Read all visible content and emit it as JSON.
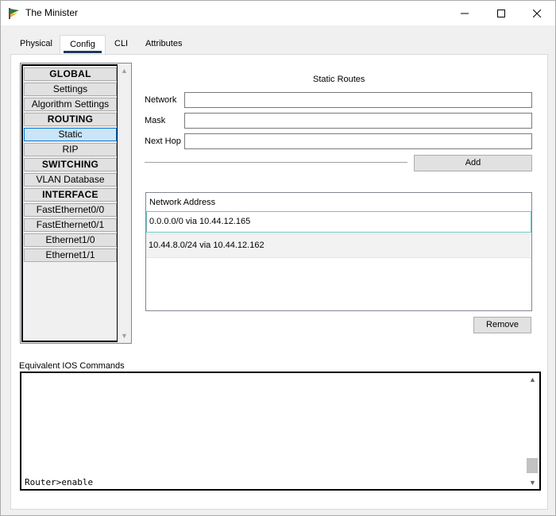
{
  "window": {
    "title": "The Minister"
  },
  "tabs": [
    {
      "label": "Physical"
    },
    {
      "label": "Config"
    },
    {
      "label": "CLI"
    },
    {
      "label": "Attributes"
    }
  ],
  "nav": {
    "items": [
      {
        "label": "GLOBAL",
        "kind": "header"
      },
      {
        "label": "Settings",
        "kind": "item"
      },
      {
        "label": "Algorithm Settings",
        "kind": "item"
      },
      {
        "label": "ROUTING",
        "kind": "header"
      },
      {
        "label": "Static",
        "kind": "item",
        "selected": true
      },
      {
        "label": "RIP",
        "kind": "item"
      },
      {
        "label": "SWITCHING",
        "kind": "header"
      },
      {
        "label": "VLAN Database",
        "kind": "item"
      },
      {
        "label": "INTERFACE",
        "kind": "header"
      },
      {
        "label": "FastEthernet0/0",
        "kind": "item"
      },
      {
        "label": "FastEthernet0/1",
        "kind": "item"
      },
      {
        "label": "Ethernet1/0",
        "kind": "item"
      },
      {
        "label": "Ethernet1/1",
        "kind": "item"
      }
    ]
  },
  "static_routes": {
    "title": "Static Routes",
    "network_label": "Network",
    "network_value": "",
    "mask_label": "Mask",
    "mask_value": "",
    "nexthop_label": "Next Hop",
    "nexthop_value": "",
    "add_label": "Add",
    "list_header": "Network Address",
    "routes": [
      "0.0.0.0/0 via 10.44.12.165",
      "10.44.8.0/24 via 10.44.12.162"
    ],
    "remove_label": "Remove"
  },
  "ios": {
    "label": "Equivalent IOS Commands",
    "console_text": "Router>enable"
  },
  "colors": {
    "tab_underline": "#1f3a57",
    "selected_item_bg": "#cce4f7",
    "selected_row_border": "#6ec5c5"
  }
}
